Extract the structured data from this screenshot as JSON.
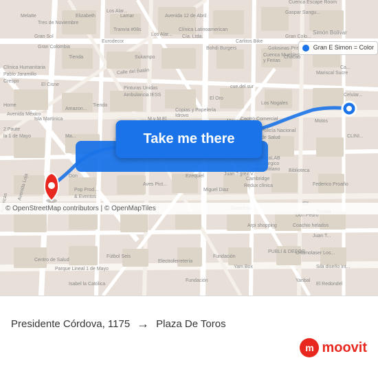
{
  "map": {
    "attribution": "© OpenStreetMap contributors | © OpenMapTiles",
    "route_line_color": "#1a73e8",
    "gran_simon_badge": "Gran E Simon = Color",
    "take_me_there_label": "Take me there"
  },
  "bottom_bar": {
    "origin": "Presidente Córdova, 1175",
    "destination": "Plaza De Toros",
    "arrow": "→"
  },
  "moovit": {
    "logo_text": "moovit",
    "logo_icon": "m"
  }
}
